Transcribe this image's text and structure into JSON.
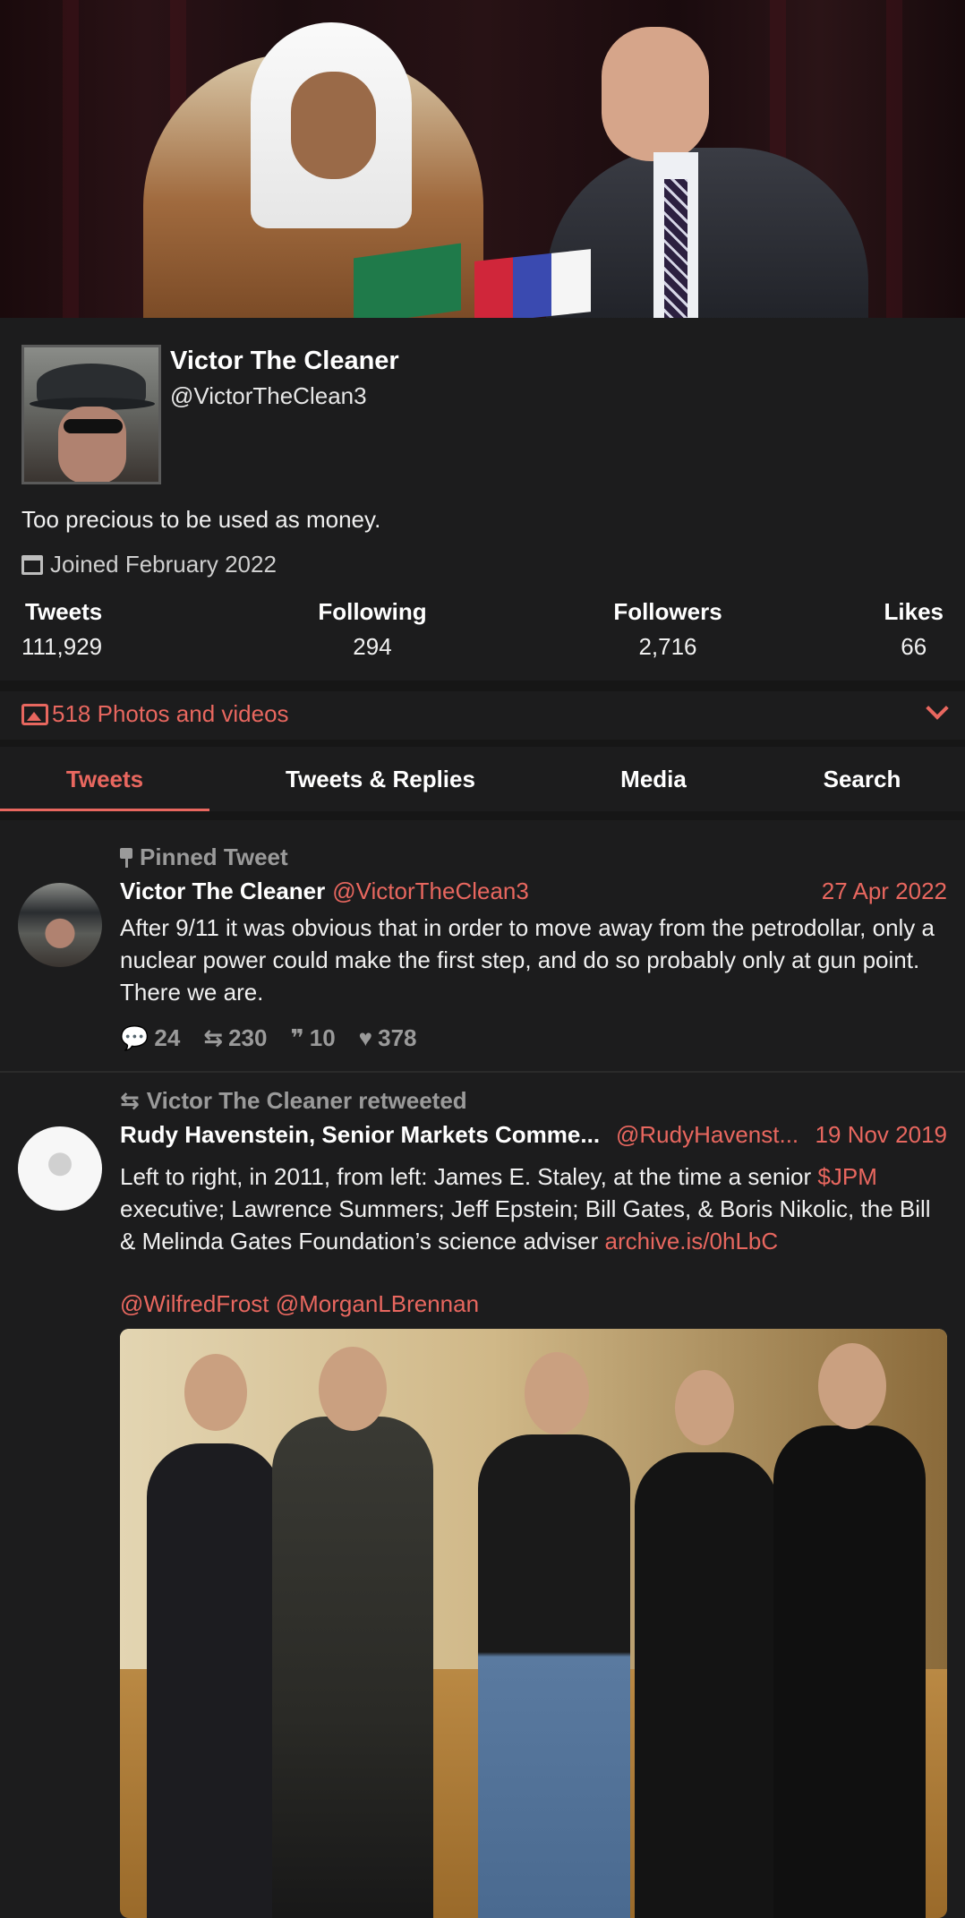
{
  "profile": {
    "name": "Victor The Cleaner",
    "handle": "@VictorTheClean3",
    "bio": "Too precious to be used as money.",
    "joined": "Joined February 2022",
    "stats": [
      {
        "label": "Tweets",
        "value": "111,929"
      },
      {
        "label": "Following",
        "value": "294"
      },
      {
        "label": "Followers",
        "value": "2,716"
      },
      {
        "label": "Likes",
        "value": "66"
      }
    ]
  },
  "photos": {
    "label": "518 Photos and videos"
  },
  "tabs": [
    {
      "label": "Tweets",
      "active": true
    },
    {
      "label": "Tweets & Replies",
      "active": false
    },
    {
      "label": "Media",
      "active": false
    },
    {
      "label": "Search",
      "active": false
    }
  ],
  "tweets": [
    {
      "context": "Pinned Tweet",
      "author": "Victor The Cleaner",
      "handle": "@VictorTheClean3",
      "date": "27 Apr 2022",
      "text": "After 9/11 it was obvious that in order to move away from the petrodollar, only a nuclear power could make the first step, and do so probably only at gun point. There we are.",
      "replies": "24",
      "retweets": "230",
      "quotes": "10",
      "likes": "378"
    },
    {
      "context": "Victor The Cleaner retweeted",
      "author": "Rudy Havenstein, Senior Markets Comme...",
      "handle": "@RudyHavenst...",
      "date": "19 Nov 2019",
      "text_part1": "Left to right, in 2011, from left: James E. Staley, at the time a senior ",
      "cashtag": "$JPM",
      "text_part2": " executive;  Lawrence Summers; Jeff Epstein; Bill Gates, & Boris Nikolic, the Bill & Melinda Gates Foundation’s science adviser ",
      "link": "archive.is/0hLbC",
      "mention1": "@WilfredFrost",
      "mention2": "@MorganLBrennan"
    }
  ],
  "colors": {
    "accent": "#e8675f",
    "background": "#161616",
    "panel": "#1c1c1d"
  }
}
